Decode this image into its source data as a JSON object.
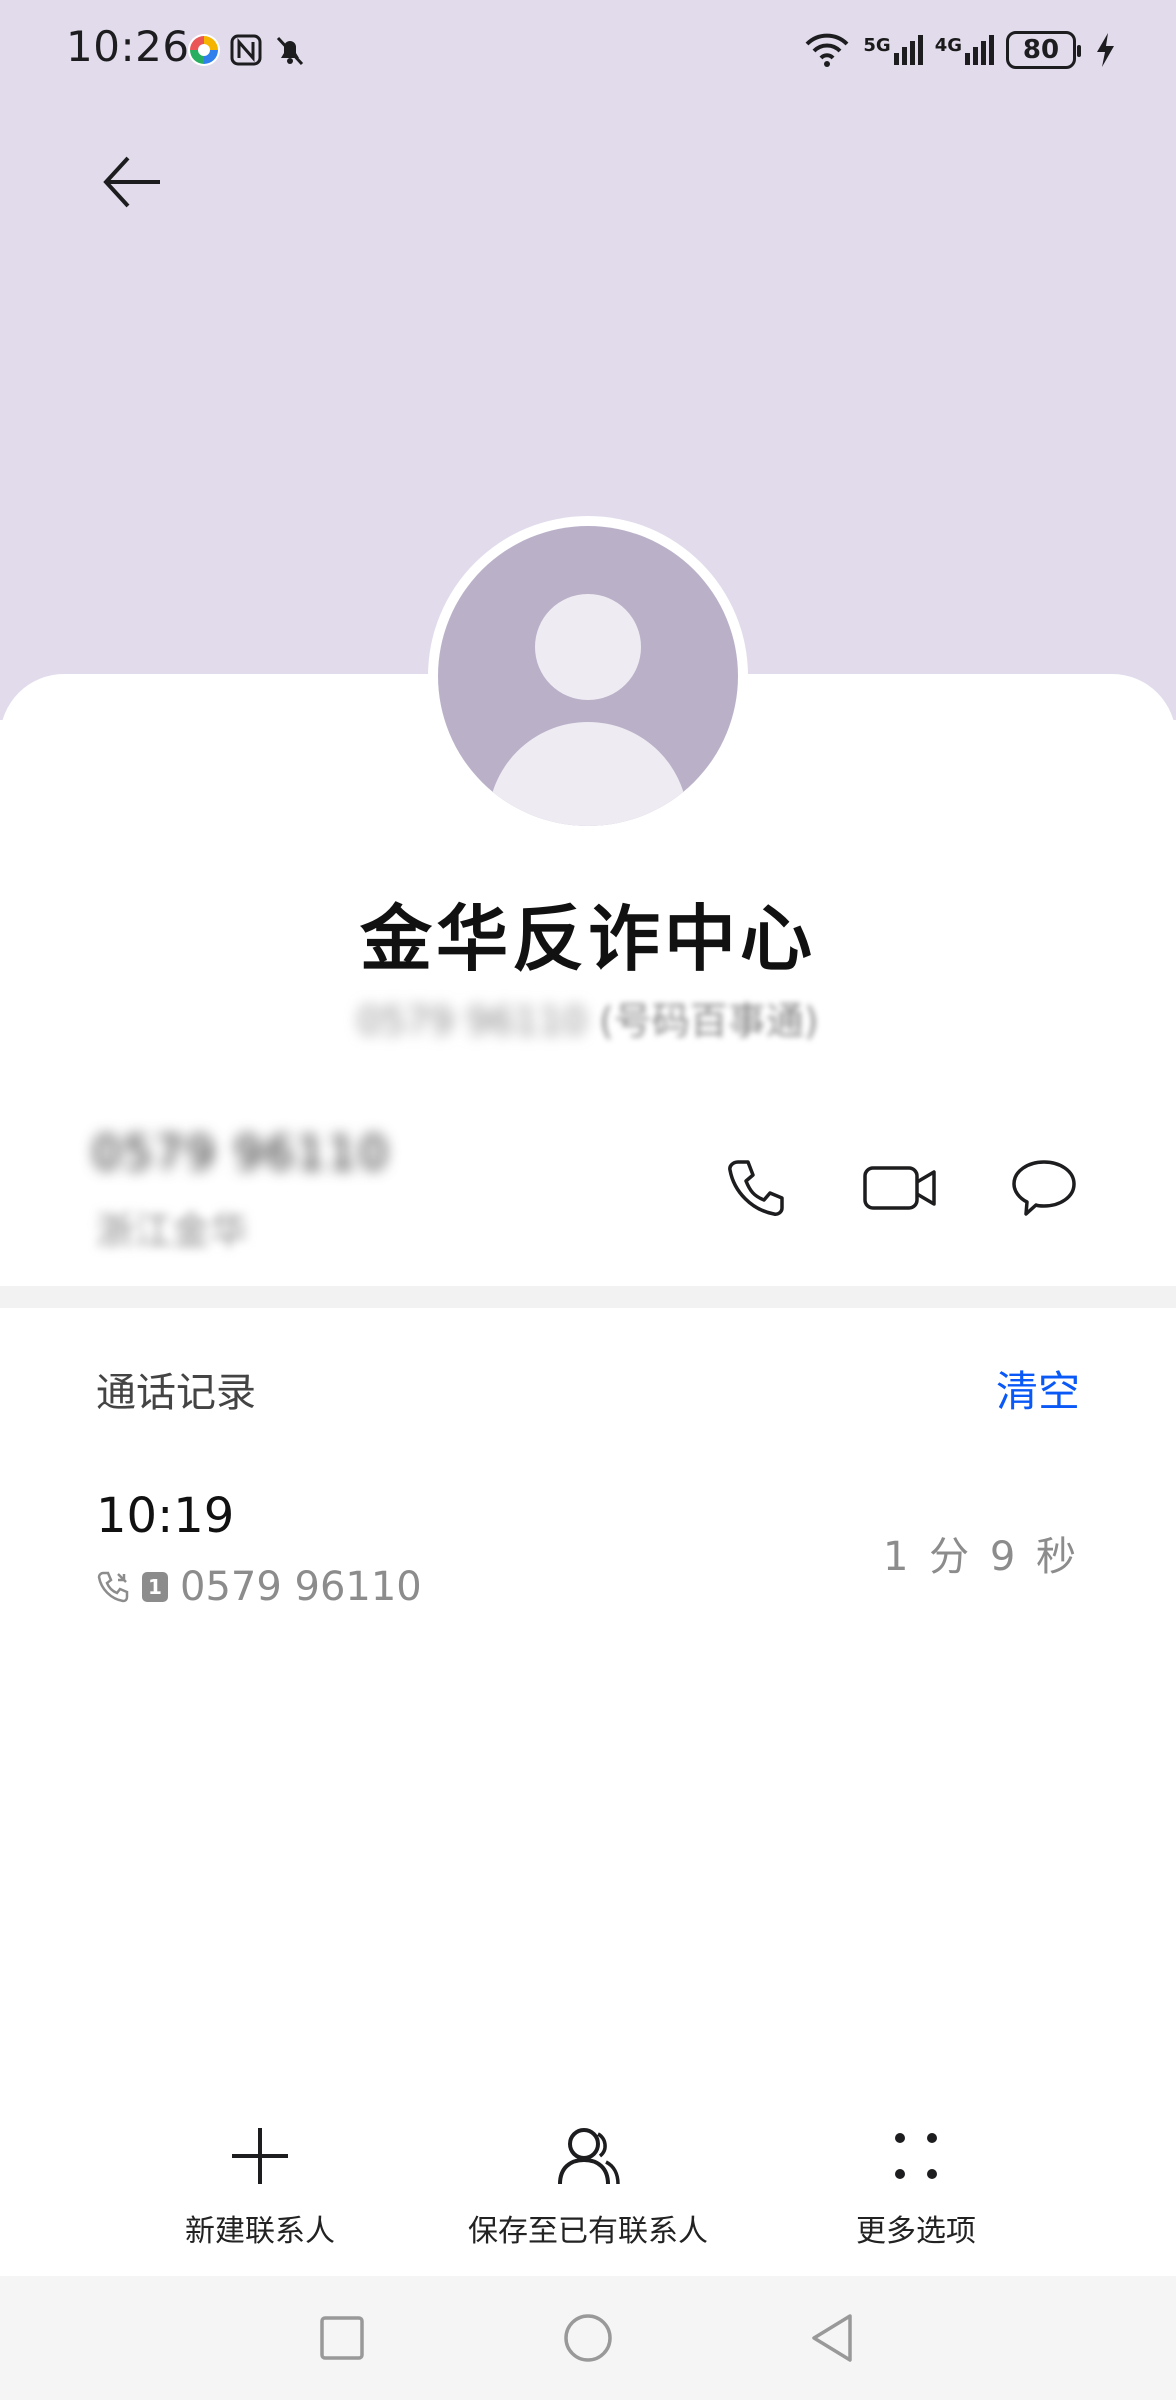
{
  "status_bar": {
    "time": "10:26",
    "battery": "80",
    "network_5g": "5G",
    "network_4g": "4G"
  },
  "contact": {
    "name": "金华反诈中心",
    "subtitle_hidden": "0579 96110",
    "subtitle_visible": "(号码百事通)"
  },
  "number": {
    "value": "0579 96110",
    "location": "浙江金华"
  },
  "call_log": {
    "title": "通话记录",
    "clear_label": "清空",
    "entries": [
      {
        "time": "10:19",
        "sim": "1",
        "number": "0579 96110",
        "duration": "1 分 9 秒"
      }
    ]
  },
  "toolbar": {
    "new_contact": "新建联系人",
    "save_existing": "保存至已有联系人",
    "more_options": "更多选项"
  },
  "colors": {
    "header_bg": "#e2dbec",
    "avatar_bg": "#bab1c9",
    "accent": "#0a59f7"
  },
  "icons": [
    "back-arrow-icon",
    "phone-icon",
    "video-call-icon",
    "message-icon",
    "plus-icon",
    "person-icon",
    "more-dots-icon",
    "incoming-call-icon",
    "square-icon",
    "circle-icon",
    "triangle-icon"
  ]
}
